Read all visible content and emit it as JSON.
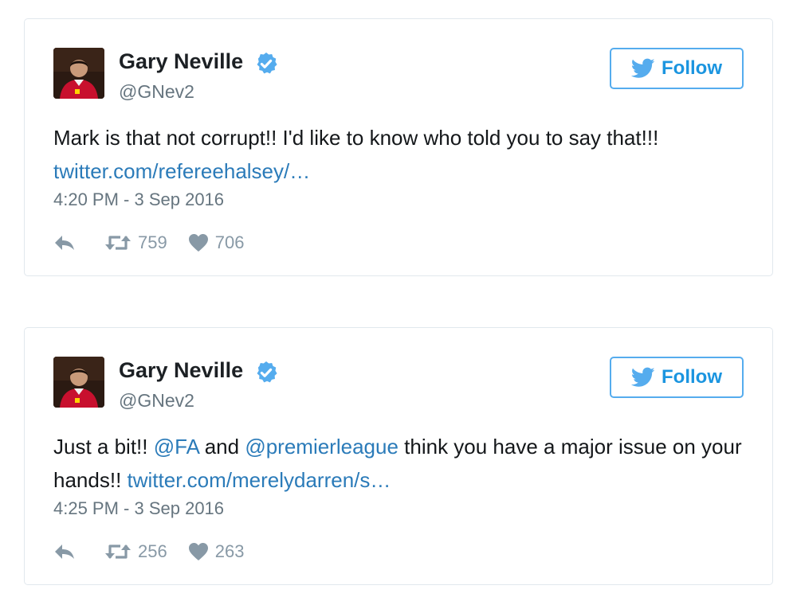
{
  "tweets": [
    {
      "name": "Gary Neville",
      "handle": "@GNev2",
      "follow_label": "Follow",
      "text_parts": [
        {
          "text": "Mark is that not corrupt!! I'd like to know who told you to say that!!! ",
          "link": false
        },
        {
          "text": "twitter.com/refereehalsey/…",
          "link": true
        }
      ],
      "timestamp": "4:20 PM - 3 Sep 2016",
      "retweets": "759",
      "likes": "706"
    },
    {
      "name": "Gary Neville",
      "handle": "@GNev2",
      "follow_label": "Follow",
      "text_parts": [
        {
          "text": "Just a bit!! ",
          "link": false
        },
        {
          "text": "@FA",
          "link": true
        },
        {
          "text": " and ",
          "link": false
        },
        {
          "text": "@premierleague",
          "link": true
        },
        {
          "text": " think you have a major issue on your hands!! ",
          "link": false
        },
        {
          "text": "twitter.com/merelydarren/s…",
          "link": true
        }
      ],
      "timestamp": "4:25 PM - 3 Sep 2016",
      "retweets": "256",
      "likes": "263"
    }
  ],
  "icons": {
    "verified": "verified-badge-icon",
    "follow": "twitter-bird-icon",
    "reply": "reply-icon",
    "retweet": "retweet-icon",
    "like": "heart-icon"
  },
  "colors": {
    "accent": "#1b95e0",
    "link": "#2b7bb9",
    "border": "#e1e8ed",
    "muted": "#66757f",
    "action": "#8899a6",
    "verified": "#55acee"
  }
}
